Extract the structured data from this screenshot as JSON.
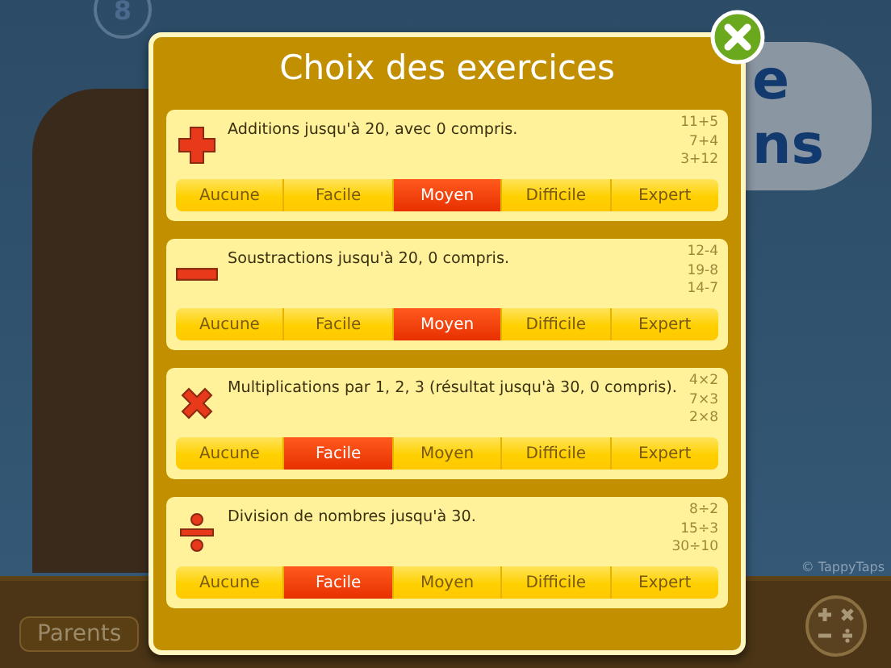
{
  "background": {
    "badge": "8",
    "title_lines": [
      "e",
      "ns"
    ],
    "copyright": "© TappyTaps",
    "parents_button": "Parents"
  },
  "dialog": {
    "title": "Choix des exercices",
    "exercises": [
      {
        "kind": "plus",
        "description": "Additions jusqu'à 20, avec 0 compris.",
        "examples": [
          "11+5",
          "7+4",
          "3+12"
        ],
        "levels": [
          {
            "label": "Aucune",
            "selected": false
          },
          {
            "label": "Facile",
            "selected": false
          },
          {
            "label": "Moyen",
            "selected": true
          },
          {
            "label": "Difficile",
            "selected": false
          },
          {
            "label": "Expert",
            "selected": false
          }
        ]
      },
      {
        "kind": "minus",
        "description": "Soustractions jusqu'à 20, 0 compris.",
        "examples": [
          "12-4",
          "19-8",
          "14-7"
        ],
        "levels": [
          {
            "label": "Aucune",
            "selected": false
          },
          {
            "label": "Facile",
            "selected": false
          },
          {
            "label": "Moyen",
            "selected": true
          },
          {
            "label": "Difficile",
            "selected": false
          },
          {
            "label": "Expert",
            "selected": false
          }
        ]
      },
      {
        "kind": "times",
        "description": "Multiplications par 1, 2, 3 (résultat jusqu'à 30, 0 compris).",
        "examples": [
          "4×2",
          "7×3",
          "2×8"
        ],
        "levels": [
          {
            "label": "Aucune",
            "selected": false
          },
          {
            "label": "Facile",
            "selected": true
          },
          {
            "label": "Moyen",
            "selected": false
          },
          {
            "label": "Difficile",
            "selected": false
          },
          {
            "label": "Expert",
            "selected": false
          }
        ]
      },
      {
        "kind": "divide",
        "description": "Division de nombres jusqu'à 30.",
        "examples": [
          "8÷2",
          "15÷3",
          "30÷10"
        ],
        "levels": [
          {
            "label": "Aucune",
            "selected": false
          },
          {
            "label": "Facile",
            "selected": true
          },
          {
            "label": "Moyen",
            "selected": false
          },
          {
            "label": "Difficile",
            "selected": false
          },
          {
            "label": "Expert",
            "selected": false
          }
        ]
      }
    ]
  }
}
